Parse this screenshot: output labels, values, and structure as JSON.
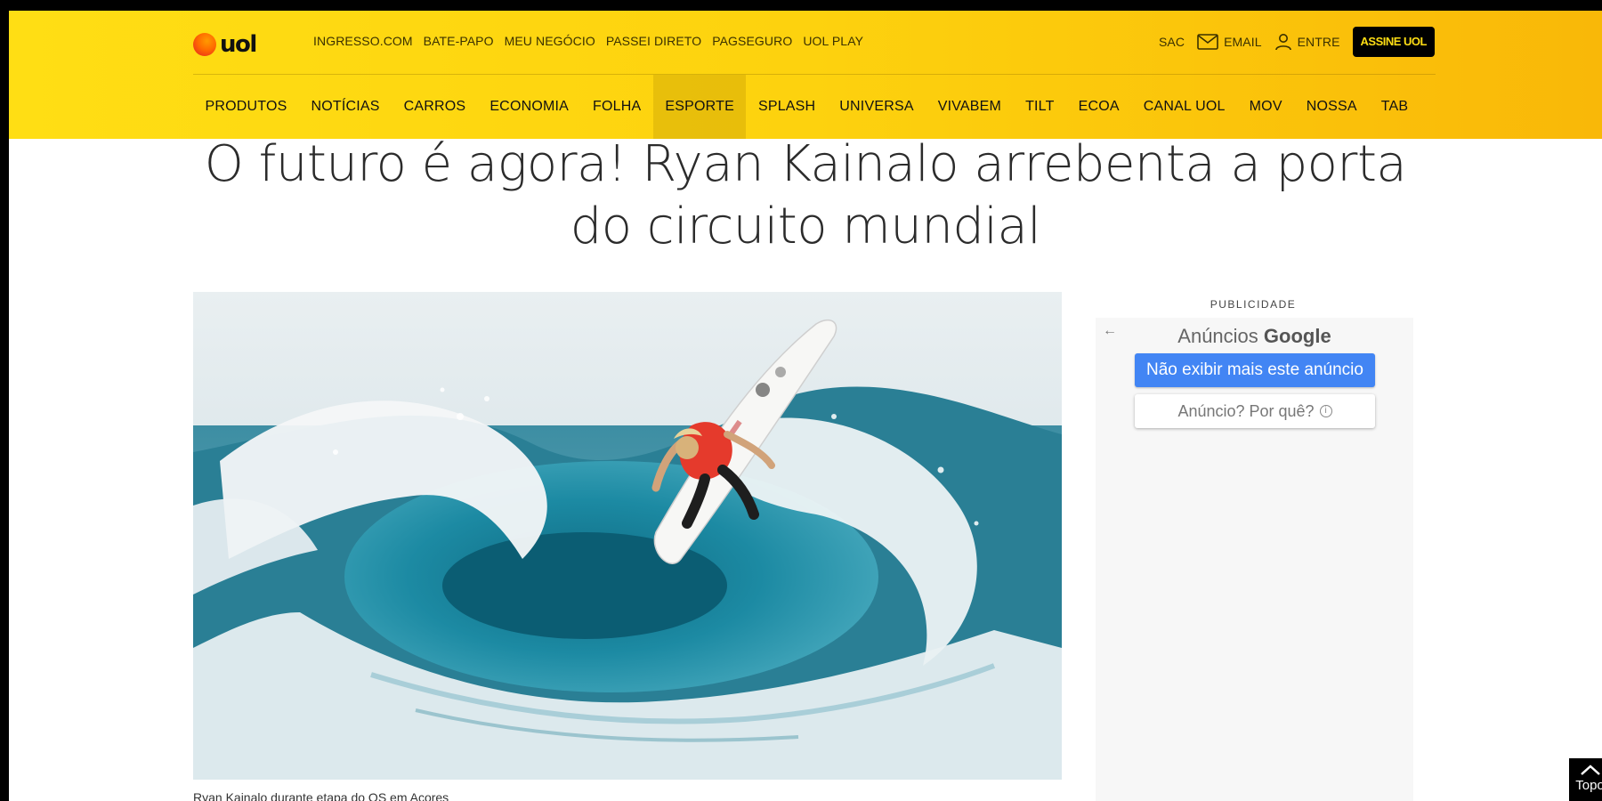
{
  "header": {
    "logo_text": "uol",
    "top_links": [
      "INGRESSO.COM",
      "BATE-PAPO",
      "MEU NEGÓCIO",
      "PASSEI DIRETO",
      "PAGSEGURO",
      "UOL PLAY"
    ],
    "utility": {
      "sac": "SAC",
      "email": "EMAIL",
      "login": "ENTRE",
      "subscribe": "ASSINE UOL"
    },
    "nav": [
      "PRODUTOS",
      "NOTÍCIAS",
      "CARROS",
      "ECONOMIA",
      "FOLHA",
      "ESPORTE",
      "SPLASH",
      "UNIVERSA",
      "VIVABEM",
      "TILT",
      "ECOA",
      "CANAL UOL",
      "MOV",
      "NOSSA",
      "TAB"
    ],
    "active_nav": "ESPORTE",
    "colors": {
      "yellow": "#ffde14",
      "orange": "#f9b808",
      "subscribe_bg": "#000000"
    }
  },
  "article": {
    "headline_line1": "O futuro é agora! Ryan Kainalo arrebenta a porta",
    "headline_line2": "do circuito mundial",
    "photo_icon": "surfer-photo",
    "caption": "Ryan Kainalo durante etapa do QS em Açores"
  },
  "ad": {
    "label": "PUBLICIDADE",
    "back_icon": "back-arrow-icon",
    "heading_prefix": "Anúncios",
    "heading_brand": "Google",
    "hide_button": "Não exibir mais este anúncio",
    "why_button": "Anúncio? Por quê?",
    "primary_color": "#4285f4"
  },
  "to_top": {
    "label": "Topo"
  }
}
